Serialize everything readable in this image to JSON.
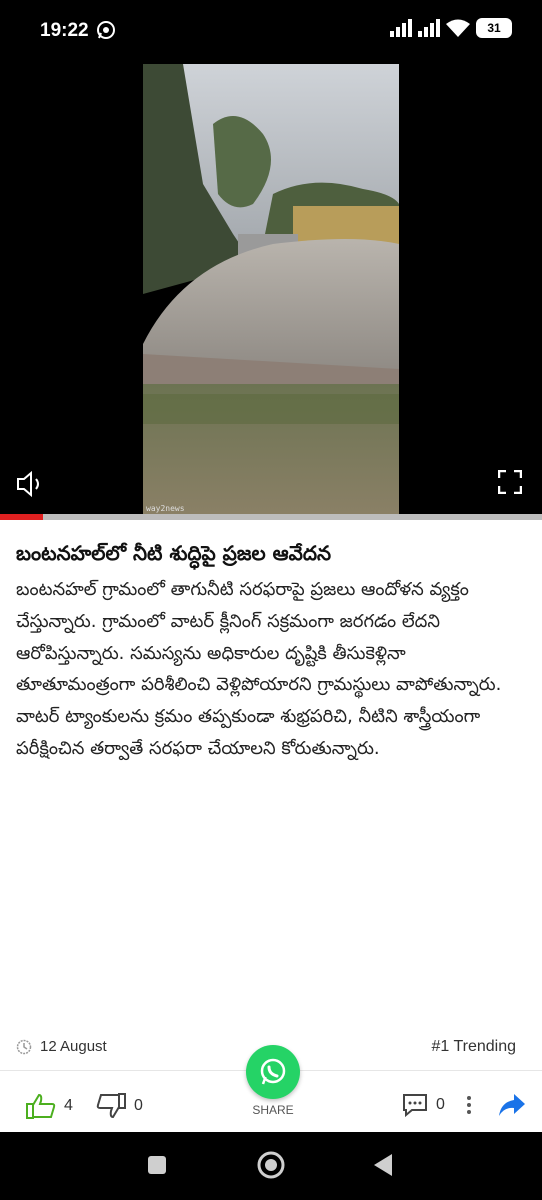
{
  "status_bar": {
    "time": "19:22",
    "battery": "31",
    "icons": [
      "whatsapp-icon",
      "signal-icon",
      "signal-icon",
      "wifi-icon",
      "battery-icon"
    ]
  },
  "video": {
    "watermark": "way2news",
    "progress_percent": 8,
    "icons": [
      "mute-icon",
      "fullscreen-icon"
    ]
  },
  "article": {
    "title": "బంటనహల్‌లో నీటి శుద్ధిపై ప్రజల ఆవేదన",
    "body": "బంటనహల్ గ్రామంలో తాగునీటి సరఫరాపై ప్రజలు ఆందోళన వ్యక్తం చేస్తున్నారు. గ్రామంలో వాటర్ క్లీనింగ్ సక్రమంగా జరగడం లేదని ఆరోపిస్తున్నారు. సమస్యను అధికారుల దృష్టికి తీసుకెళ్లినా తూతూమంత్రంగా పరిశీలించి వెళ్లిపోయారని గ్రామస్థులు వాపోతున్నారు. వాటర్ ట్యాంకులను క్రమం తప్పకుండా శుభ్రపరిచి, నీటిని శాస్త్రీయంగా పరీక్షించిన తర్వాతే సరఫరా చేయాలని కోరుతున్నారు."
  },
  "meta": {
    "date": "12 August",
    "trending": "#1 Trending"
  },
  "actions": {
    "likes": "4",
    "dislikes": "0",
    "share_label": "SHARE",
    "comments": "0"
  },
  "colors": {
    "like_green": "#4caf1f",
    "share_blue": "#1a73e8",
    "whatsapp_green": "#25D366",
    "progress_red": "#e02020"
  }
}
